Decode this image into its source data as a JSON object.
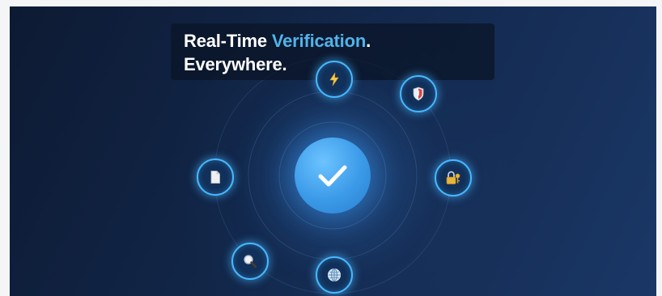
{
  "headline": {
    "line1_prefix": "Real-Time ",
    "line1_accent": "Verification",
    "line1_suffix": ".",
    "line2": "Everywhere."
  },
  "center": {
    "icon": "checkmark-icon"
  },
  "orbit_icons": [
    {
      "name": "lightning-icon"
    },
    {
      "name": "shield-icon"
    },
    {
      "name": "lock-key-icon"
    },
    {
      "name": "globe-icon"
    },
    {
      "name": "magnifier-icon"
    },
    {
      "name": "document-icon"
    }
  ],
  "colors": {
    "background_dark": "#0d1a33",
    "background_light": "#1a3766",
    "accent": "#4fb4ea",
    "ring": "#47b8ff",
    "badge": "#3b9ae8"
  }
}
